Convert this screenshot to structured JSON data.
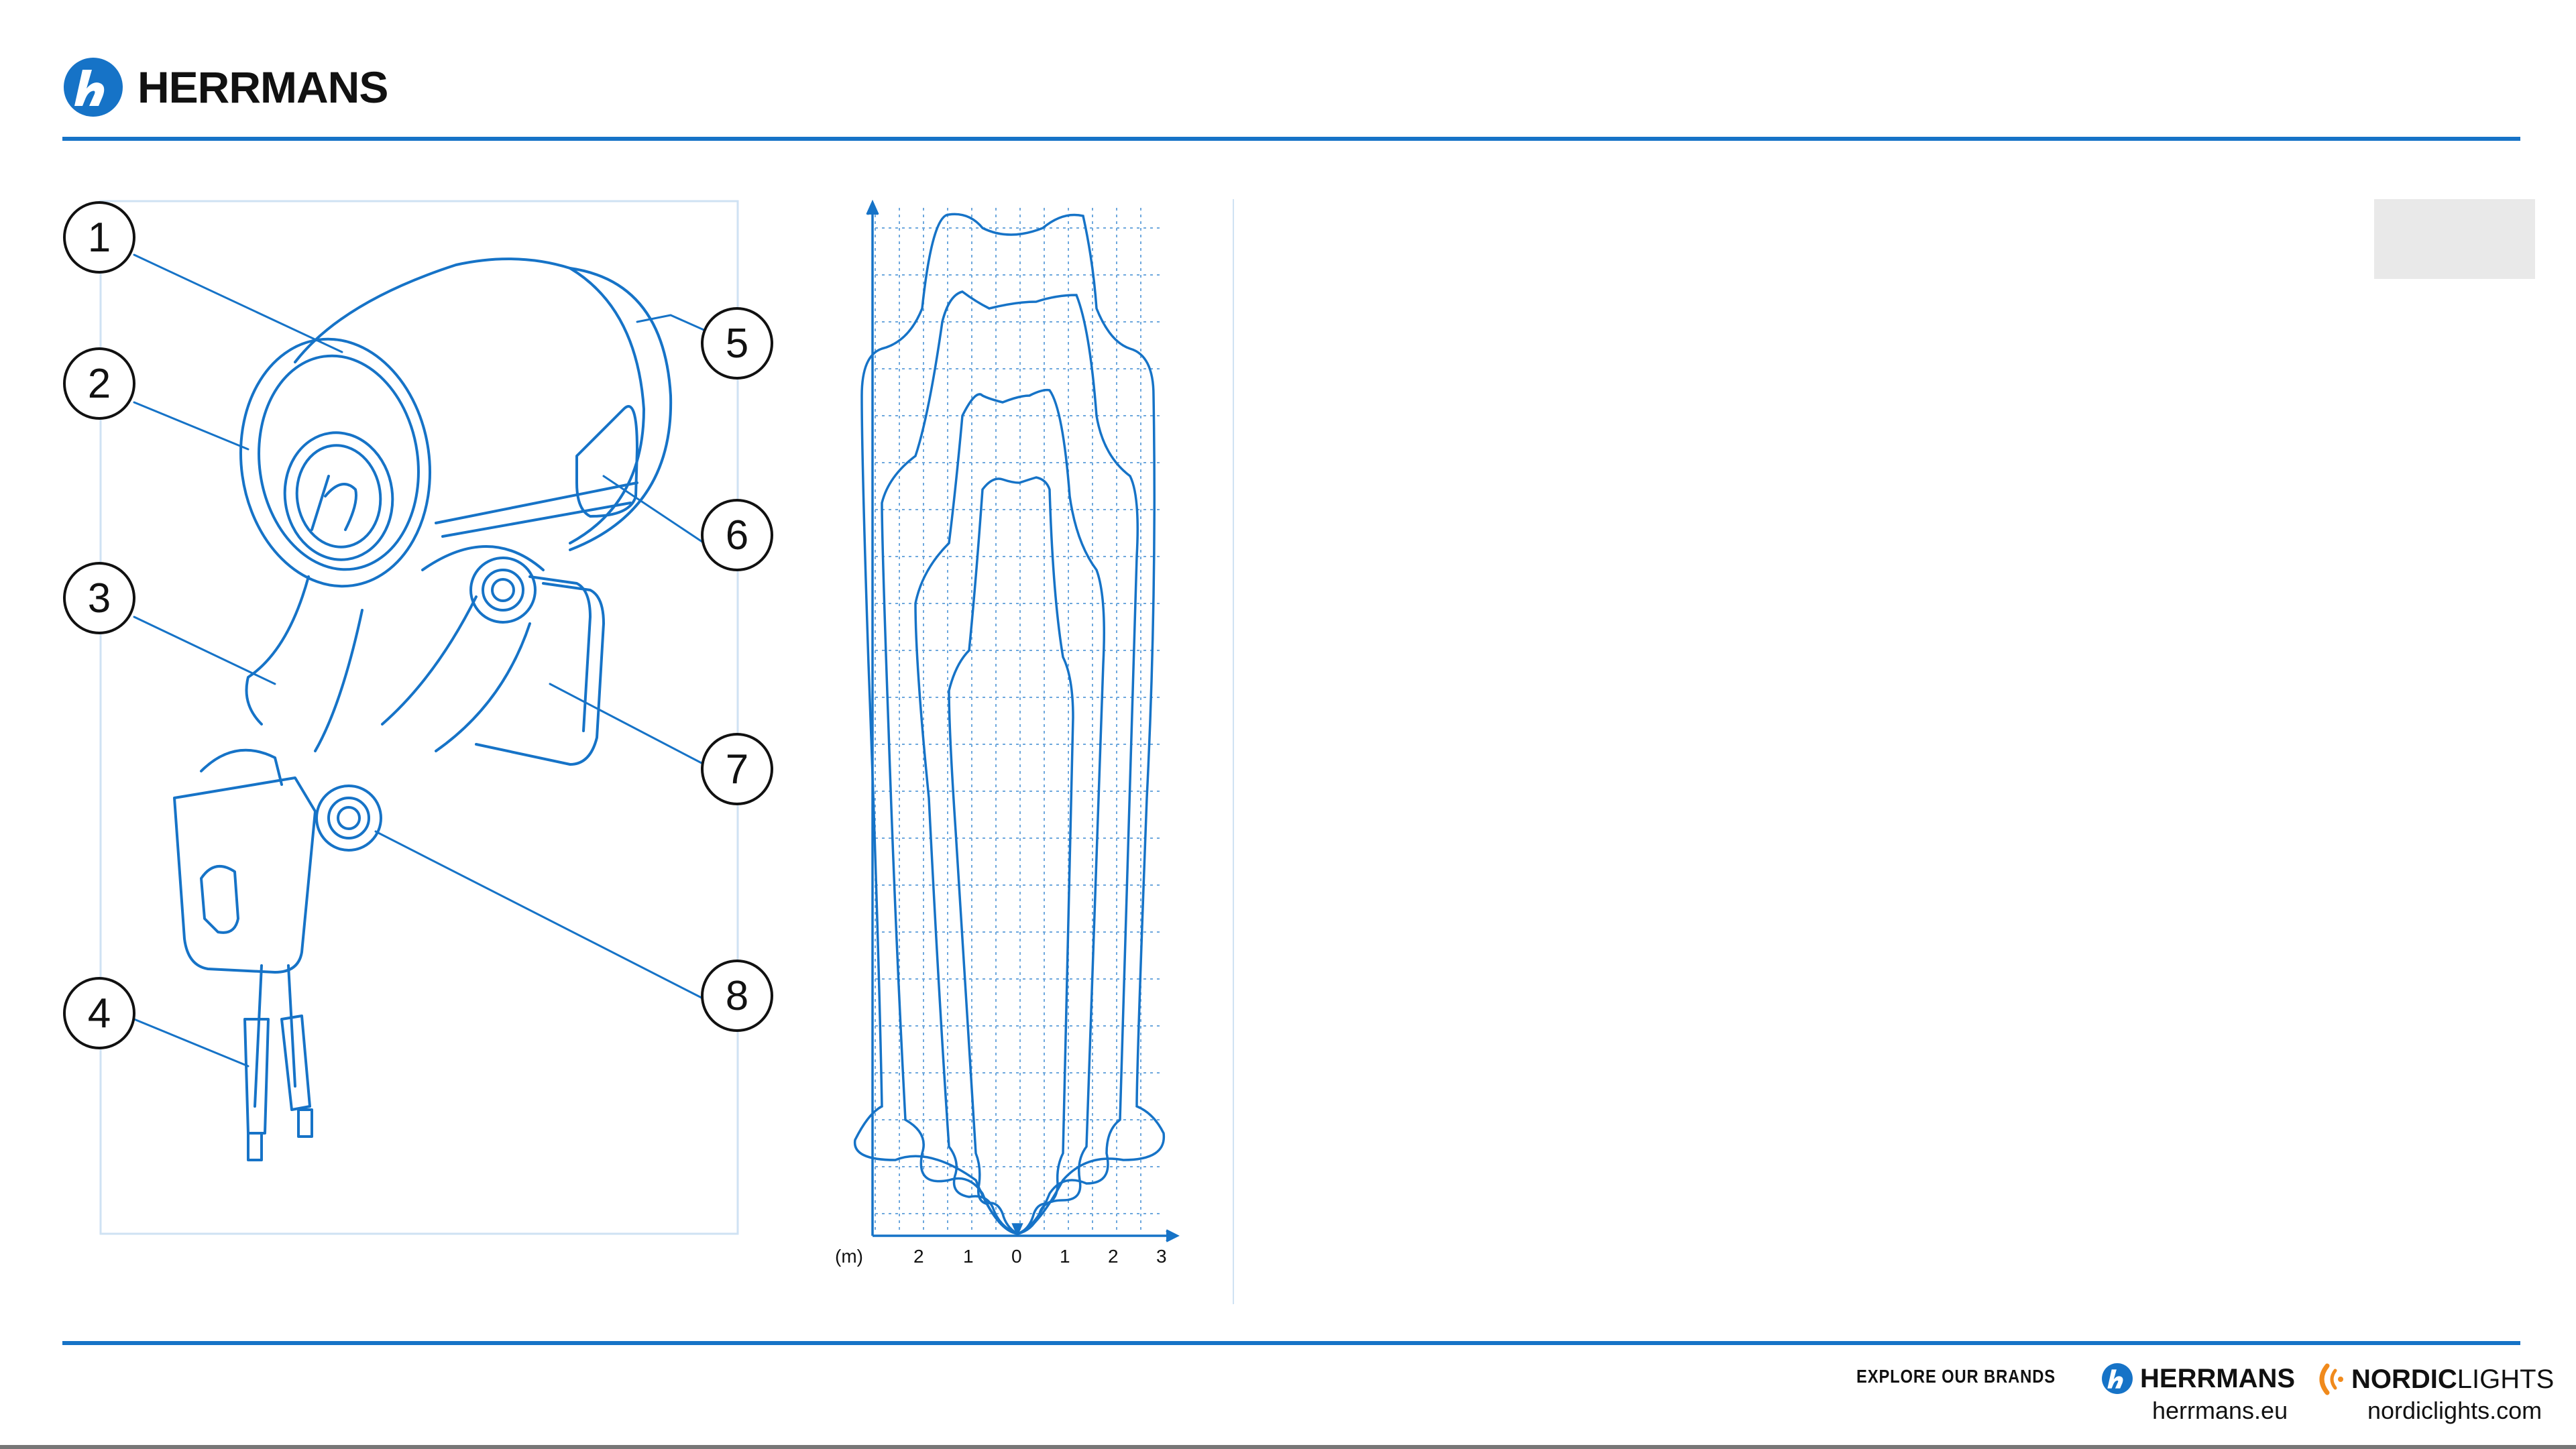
{
  "header": {
    "brand_name": "HERRMANS"
  },
  "colors": {
    "accent": "#1673c7",
    "drawing": "#1673c7",
    "grey_tab": "#e9e9e9"
  },
  "diagram": {
    "callouts": [
      "1",
      "2",
      "3",
      "4",
      "5",
      "6",
      "7",
      "8"
    ]
  },
  "beam_pattern": {
    "unit_label": "(m)",
    "x_ticks": [
      "2",
      "1",
      "0",
      "1",
      "2",
      "3"
    ]
  },
  "footer": {
    "explore_label": "EXPLORE OUR BRANDS",
    "brand1_name": "HERRMANS",
    "brand1_url": "herrmans.eu",
    "brand2_name_bold": "NORDIC",
    "brand2_name_light": "LIGHTS",
    "brand2_url": "nordiclights.com"
  },
  "icons": {
    "herrmans_logo": "herrmans-logo-icon",
    "nordiclights_logo": "nordiclights-logo-icon"
  }
}
